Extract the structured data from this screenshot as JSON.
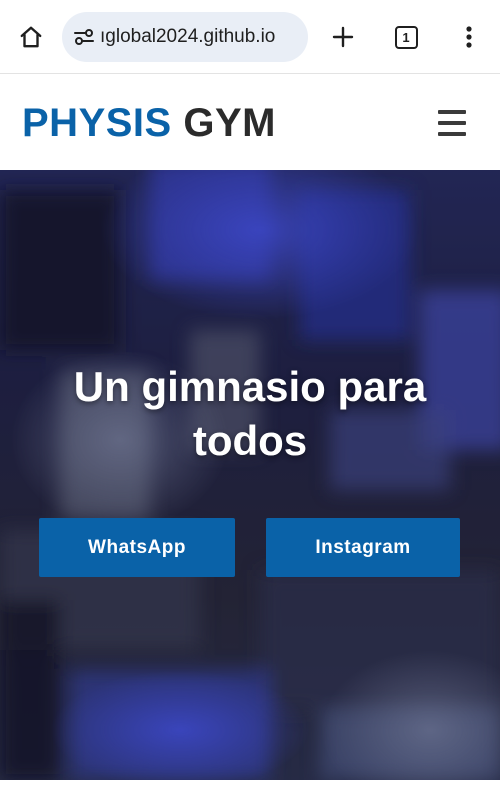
{
  "browser": {
    "url": "ıglobal2024.github.io",
    "tab_count": "1",
    "icons": [
      "home-icon",
      "site-info-icon",
      "plus-icon",
      "tab-switcher-icon",
      "more-vert-icon"
    ]
  },
  "header": {
    "brand_part1": "PHYSIS",
    "brand_part2": "GYM",
    "brand_color": "#0a62a8",
    "menu_icon": "hamburger-menu-icon"
  },
  "hero": {
    "title": "Un gimnasio para todos",
    "buttons": [
      {
        "label": "WhatsApp"
      },
      {
        "label": "Instagram"
      }
    ],
    "button_color": "#0a62a8"
  }
}
